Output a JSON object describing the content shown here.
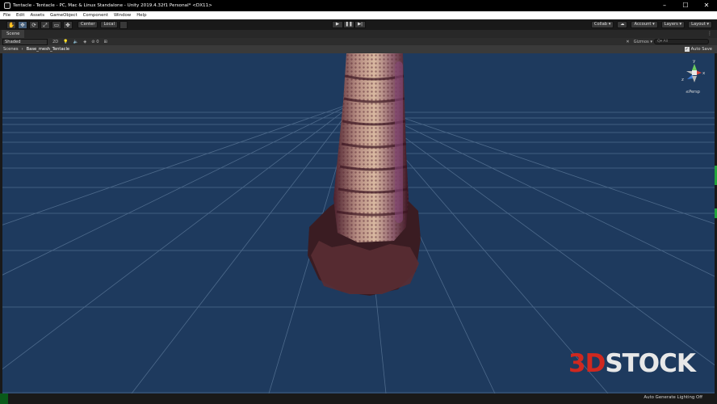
{
  "window": {
    "title": "Tentacle - Tentacle - PC, Mac & Linux Standalone - Unity 2019.4.32f1 Personal* <DX11>",
    "controls": [
      "–",
      "☐",
      "✕"
    ]
  },
  "menu": [
    "File",
    "Edit",
    "Assets",
    "GameObject",
    "Component",
    "Window",
    "Help"
  ],
  "toolbar": {
    "tools": [
      "✋",
      "✥",
      "⟳",
      "⤢",
      "▭",
      "✤"
    ],
    "pivot": "Center",
    "space": "Local",
    "play": "▶",
    "pause": "❚❚",
    "step": "▶|",
    "collab": "Collab ▾",
    "cloud": "☁",
    "account": "Account ▾",
    "layers": "Layers ▾",
    "layout": "Layout ▾"
  },
  "scene_tab": {
    "label": "Scene",
    "menu": "⋮"
  },
  "scene_toolbar": {
    "shading": "Shaded",
    "mode_2d": "2D",
    "light": "💡",
    "audio": "🔈",
    "fx": "◈",
    "hidden": "⊘ 0",
    "grid": "⊞",
    "tools": "✕",
    "gizmos": "Gizmos ▾",
    "search_placeholder": "Q▾ All"
  },
  "breadcrumb": {
    "root": "Scenes",
    "object": "Base_mesh_Tentacle",
    "auto_save": "Auto Save"
  },
  "gizmo": {
    "y": "y",
    "x": "x",
    "z": "z",
    "projection": "≤Persp"
  },
  "watermark": {
    "prefix": "3D",
    "suffix": "STOCK"
  },
  "status": {
    "text": "Auto Generate Lighting Off"
  },
  "colors": {
    "viewport_bg": "#1e3a5e",
    "grid_line": "#5d7a9b",
    "accent_green": "#23a33a",
    "watermark_red": "#d0281f"
  }
}
